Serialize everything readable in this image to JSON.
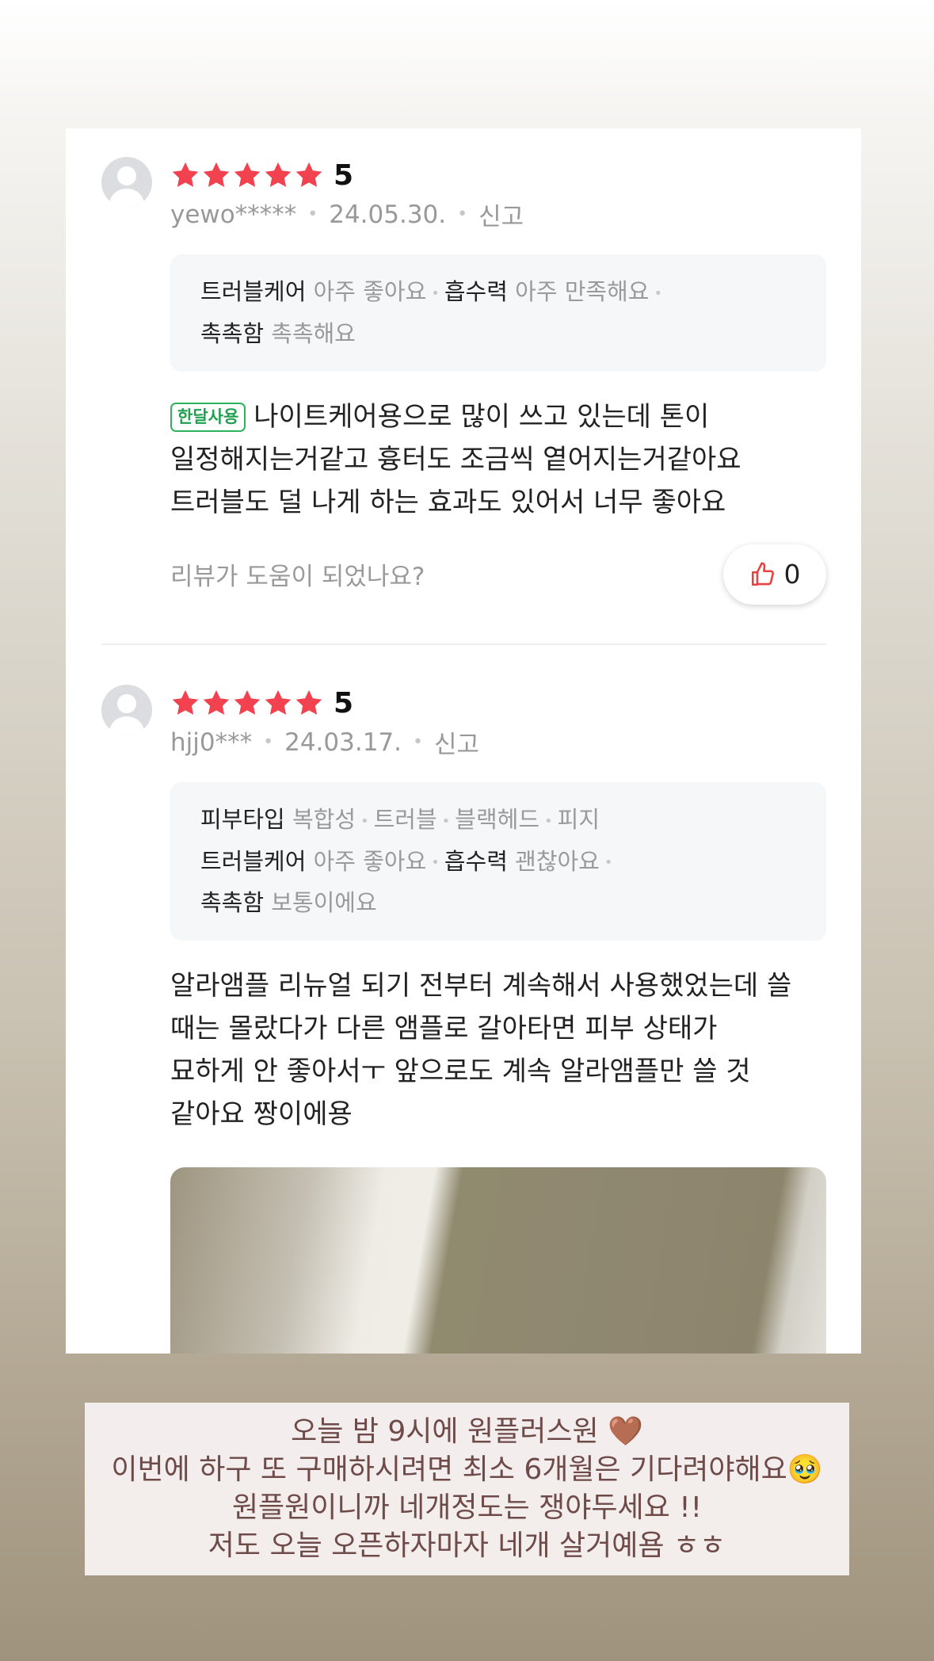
{
  "reviews": [
    {
      "rating": "5",
      "stars": 5,
      "username": "yewo*****",
      "date": "24.05.30.",
      "report_label": "신고",
      "specs": [
        [
          {
            "key": "트러블케어",
            "value": "아주 좋아요"
          },
          {
            "key": "흡수력",
            "value": "아주 만족해요"
          }
        ],
        [
          {
            "key": "촉촉함",
            "value": "촉촉해요"
          }
        ]
      ],
      "tag": "한달사용",
      "text_lines": [
        "나이트케어용으로 많이 쓰고 있는데 톤이",
        "일정해지는거같고 흉터도 조금씩 옅어지는거같아요",
        "트러블도 덜 나게 하는 효과도 있어서 너무 좋아요"
      ],
      "helpful_question": "리뷰가 도움이 되었나요?",
      "like_count": "0"
    },
    {
      "rating": "5",
      "stars": 5,
      "username": "hjj0***",
      "date": "24.03.17.",
      "report_label": "신고",
      "skin_type": {
        "key": "피부타입",
        "values": [
          "복합성",
          "트러블",
          "블랙헤드",
          "피지"
        ]
      },
      "specs": [
        [
          {
            "key": "트러블케어",
            "value": "아주 좋아요"
          },
          {
            "key": "흡수력",
            "value": "괜찮아요"
          }
        ],
        [
          {
            "key": "촉촉함",
            "value": "보통이에요"
          }
        ]
      ],
      "text_lines": [
        "알라앰플 리뉴얼 되기 전부터 계속해서 사용했었는데 쓸",
        "때는 몰랐다가 다른 앰플로 갈아타면 피부 상태가",
        "묘하게 안 좋아서ㅜ 앞으로도 계속 알라앰플만 쓸 것",
        "같아요 짱이에용"
      ]
    }
  ],
  "notice": {
    "lines": [
      "오늘 밤 9시에 원플러스원 🤎",
      "이번에 하구 또 구매하시려면 최소 6개월은 기다려야해요🥹",
      "원플원이니까 네개정도는 쟁야두세요 !!",
      "저도 오늘 오픈하자마자 네개 살거예욤 ㅎㅎ"
    ]
  },
  "colors": {
    "star": "#f2424f",
    "tag_green": "#1fa150",
    "notice_text": "#6e4a48"
  }
}
